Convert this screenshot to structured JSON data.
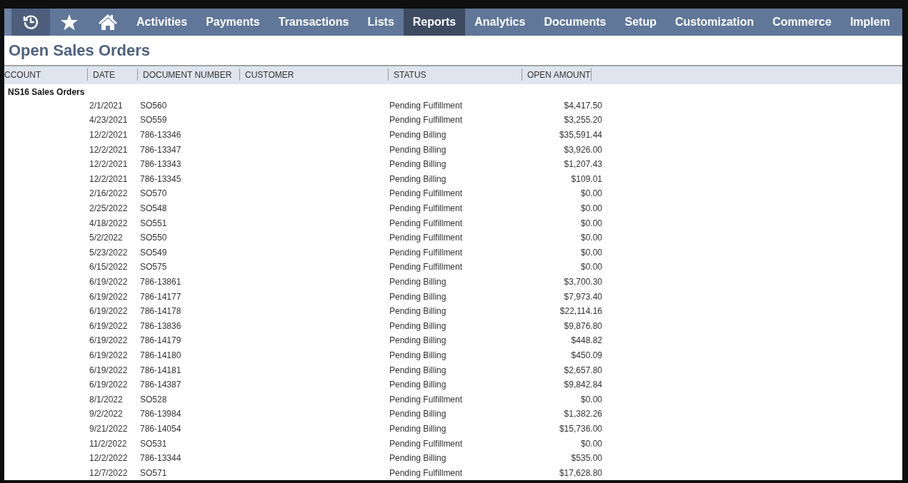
{
  "nav": {
    "icon_buttons": [
      {
        "kind": "history",
        "selected": true
      },
      {
        "kind": "star",
        "selected": false
      },
      {
        "kind": "home",
        "selected": false
      }
    ],
    "items": [
      {
        "label": "Activities",
        "selected": false
      },
      {
        "label": "Payments",
        "selected": false
      },
      {
        "label": "Transactions",
        "selected": false
      },
      {
        "label": "Lists",
        "selected": false
      },
      {
        "label": "Reports",
        "selected": true
      },
      {
        "label": "Analytics",
        "selected": false
      },
      {
        "label": "Documents",
        "selected": false
      },
      {
        "label": "Setup",
        "selected": false
      },
      {
        "label": "Customization",
        "selected": false
      },
      {
        "label": "Commerce",
        "selected": false
      },
      {
        "label": "Implem",
        "selected": false
      }
    ]
  },
  "page_title": "Open Sales Orders",
  "table": {
    "columns": [
      "CCOUNT",
      "DATE",
      "DOCUMENT NUMBER",
      "CUSTOMER",
      "STATUS",
      "OPEN AMOUNT"
    ],
    "group": "NS16 Sales Orders",
    "rows": [
      {
        "date": "2/1/2021",
        "document_number": "SO560",
        "status": "Pending Fulfillment",
        "open_amount": "$4,417.50"
      },
      {
        "date": "4/23/2021",
        "document_number": "SO559",
        "status": "Pending Fulfillment",
        "open_amount": "$3,255.20"
      },
      {
        "date": "12/2/2021",
        "document_number": "786-13346",
        "status": "Pending Billing",
        "open_amount": "$35,591.44"
      },
      {
        "date": "12/2/2021",
        "document_number": "786-13347",
        "status": "Pending Billing",
        "open_amount": "$3,926.00"
      },
      {
        "date": "12/2/2021",
        "document_number": "786-13343",
        "status": "Pending Billing",
        "open_amount": "$1,207.43"
      },
      {
        "date": "12/2/2021",
        "document_number": "786-13345",
        "status": "Pending Billing",
        "open_amount": "$109.01"
      },
      {
        "date": "2/16/2022",
        "document_number": "SO570",
        "status": "Pending Fulfillment",
        "open_amount": "$0.00"
      },
      {
        "date": "2/25/2022",
        "document_number": "SO548",
        "status": "Pending Fulfillment",
        "open_amount": "$0.00"
      },
      {
        "date": "4/18/2022",
        "document_number": "SO551",
        "status": "Pending Fulfillment",
        "open_amount": "$0.00"
      },
      {
        "date": "5/2/2022",
        "document_number": "SO550",
        "status": "Pending Fulfillment",
        "open_amount": "$0.00"
      },
      {
        "date": "5/23/2022",
        "document_number": "SO549",
        "status": "Pending Fulfillment",
        "open_amount": "$0.00"
      },
      {
        "date": "6/15/2022",
        "document_number": "SO575",
        "status": "Pending Fulfillment",
        "open_amount": "$0.00"
      },
      {
        "date": "6/19/2022",
        "document_number": "786-13861",
        "status": "Pending Billing",
        "open_amount": "$3,700.30"
      },
      {
        "date": "6/19/2022",
        "document_number": "786-14177",
        "status": "Pending Billing",
        "open_amount": "$7,973.40"
      },
      {
        "date": "6/19/2022",
        "document_number": "786-14178",
        "status": "Pending Billing",
        "open_amount": "$22,114.16"
      },
      {
        "date": "6/19/2022",
        "document_number": "786-13836",
        "status": "Pending Billing",
        "open_amount": "$9,876.80"
      },
      {
        "date": "6/19/2022",
        "document_number": "786-14179",
        "status": "Pending Billing",
        "open_amount": "$448.82"
      },
      {
        "date": "6/19/2022",
        "document_number": "786-14180",
        "status": "Pending Billing",
        "open_amount": "$450.09"
      },
      {
        "date": "6/19/2022",
        "document_number": "786-14181",
        "status": "Pending Billing",
        "open_amount": "$2,657.80"
      },
      {
        "date": "6/19/2022",
        "document_number": "786-14387",
        "status": "Pending Billing",
        "open_amount": "$9,842.84"
      },
      {
        "date": "8/1/2022",
        "document_number": "SO528",
        "status": "Pending Fulfillment",
        "open_amount": "$0.00"
      },
      {
        "date": "9/2/2022",
        "document_number": "786-13984",
        "status": "Pending Billing",
        "open_amount": "$1,382.26"
      },
      {
        "date": "9/21/2022",
        "document_number": "786-14054",
        "status": "Pending Billing",
        "open_amount": "$15,736.00"
      },
      {
        "date": "11/2/2022",
        "document_number": "SO531",
        "status": "Pending Fulfillment",
        "open_amount": "$0.00"
      },
      {
        "date": "12/2/2022",
        "document_number": "786-13344",
        "status": "Pending Billing",
        "open_amount": "$535.00"
      },
      {
        "date": "12/7/2022",
        "document_number": "SO571",
        "status": "Pending Fulfillment",
        "open_amount": "$17,628.80"
      }
    ]
  }
}
